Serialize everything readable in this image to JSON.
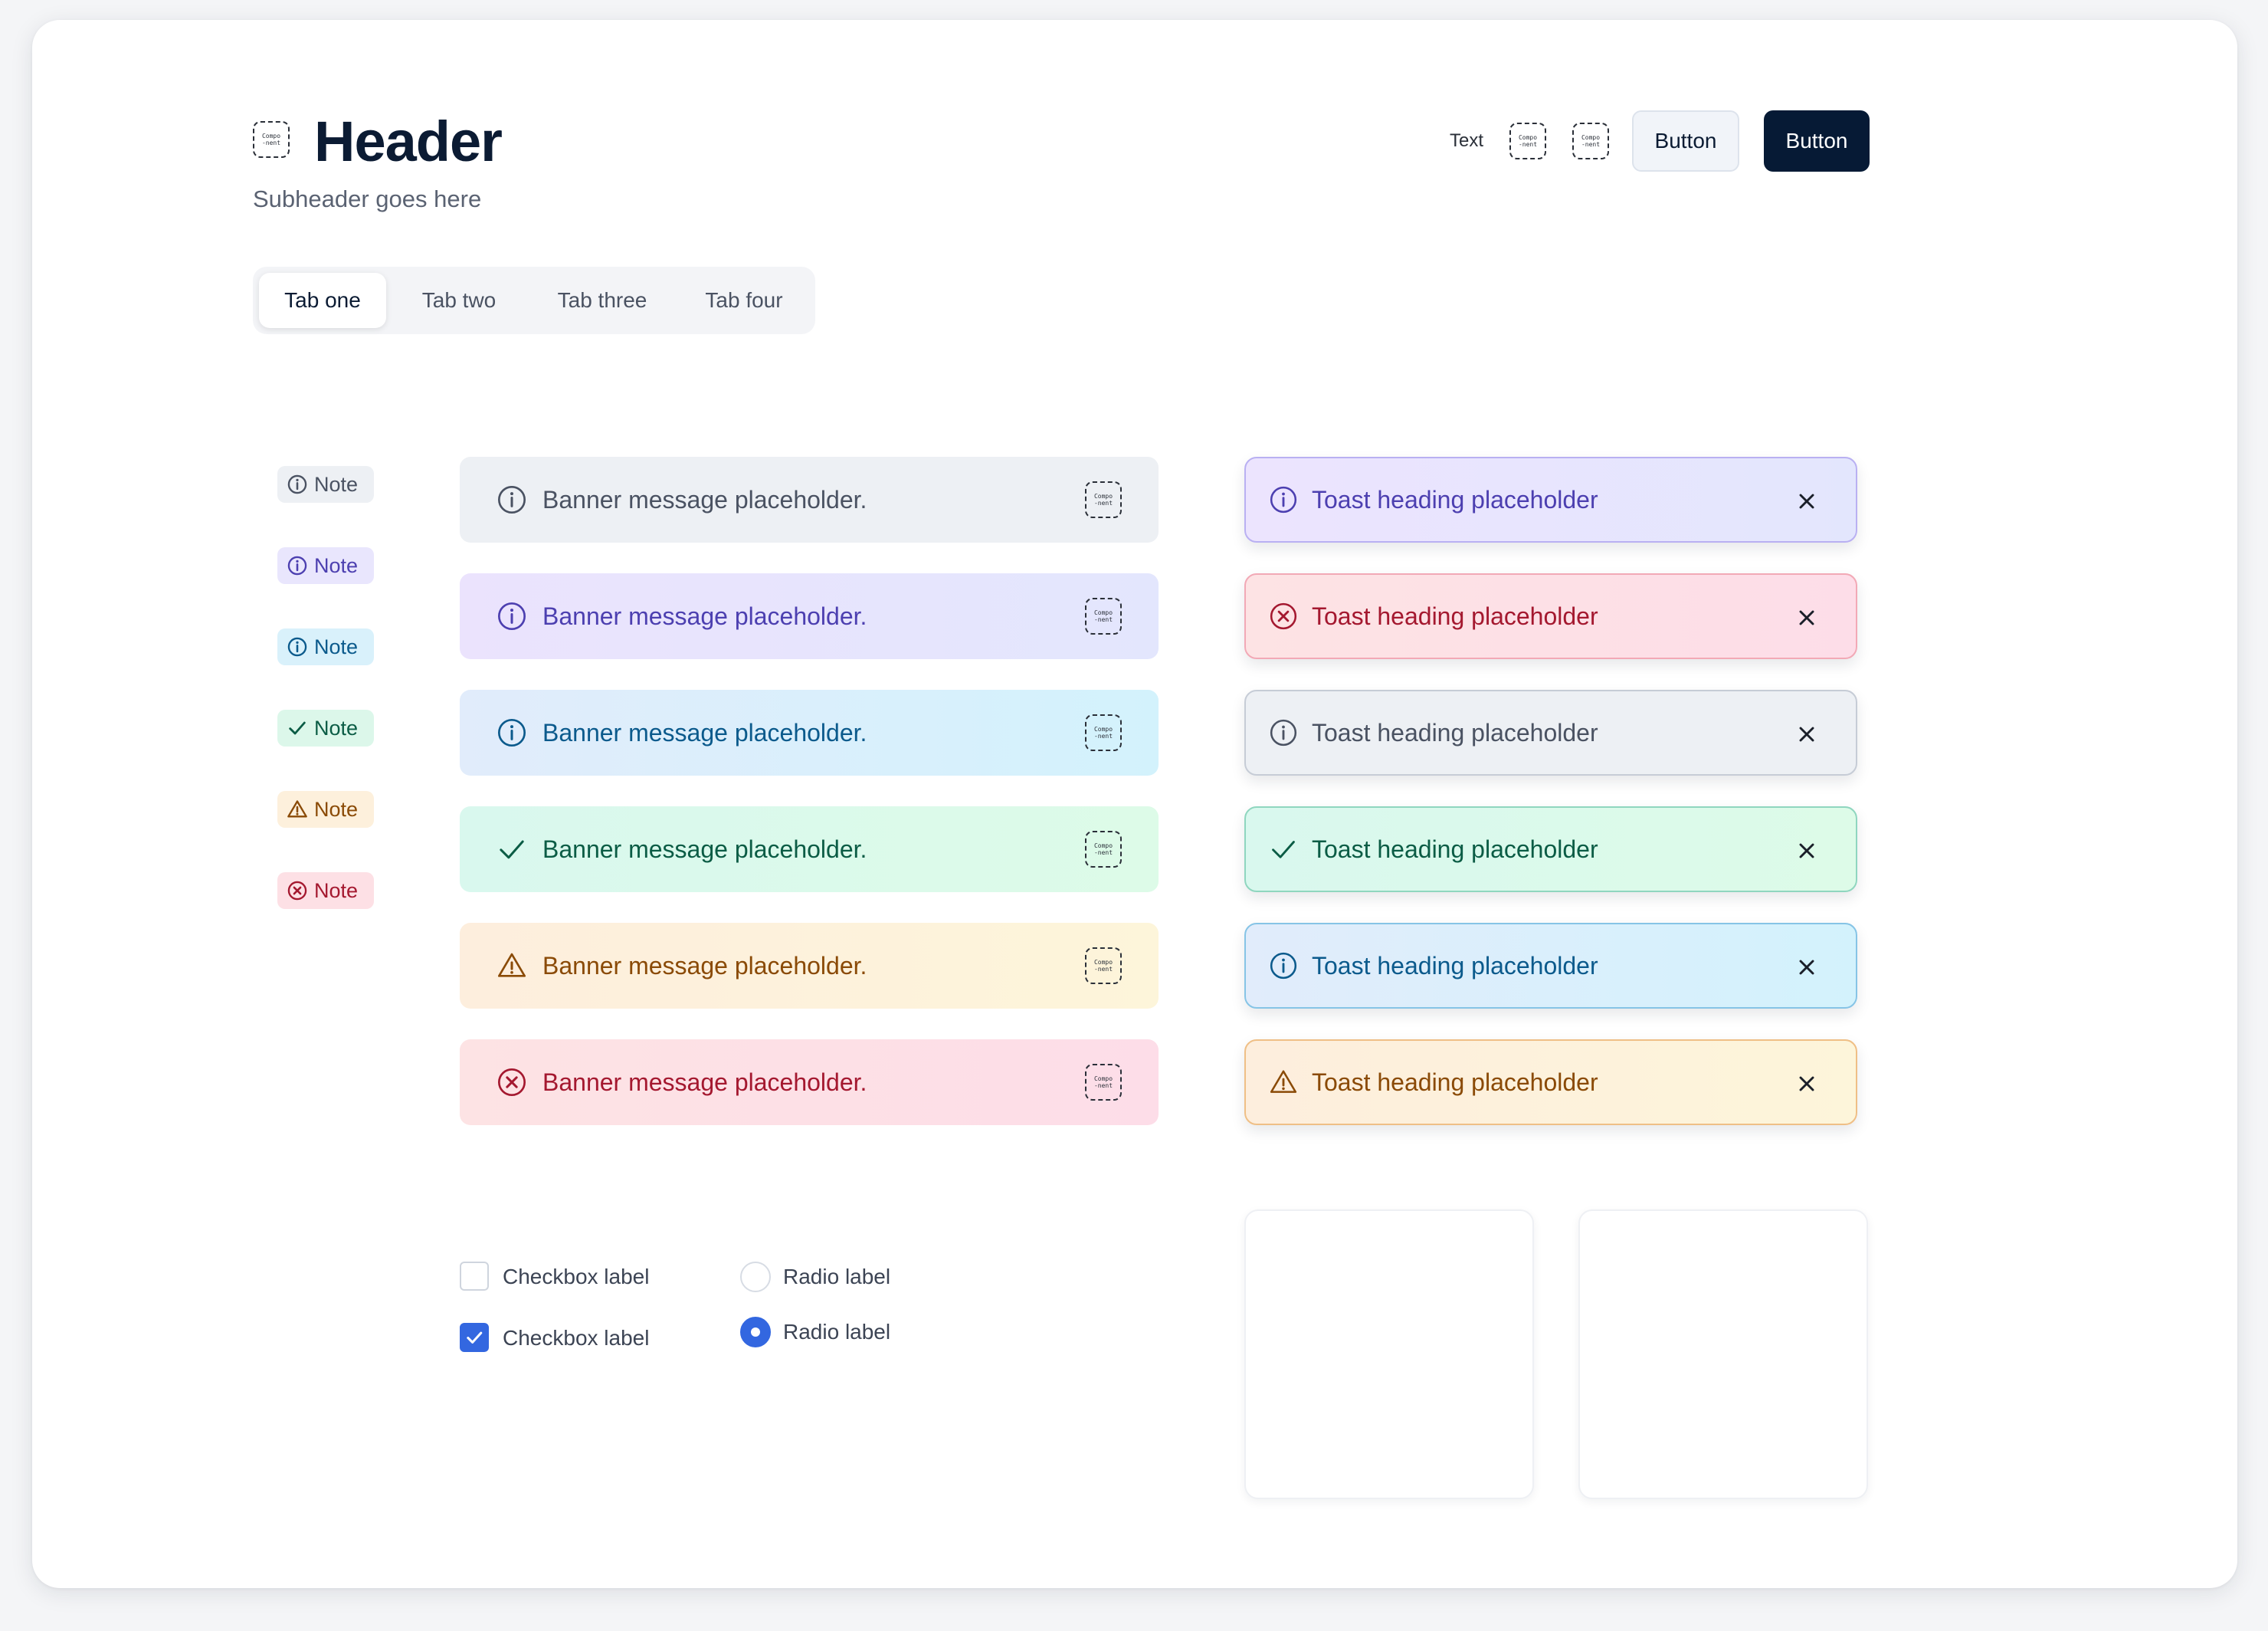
{
  "header": {
    "title": "Header",
    "subtitle": "Subheader goes here",
    "component_label_top": "Compo",
    "component_label_bottom": "-nent"
  },
  "actions": {
    "text": "Text",
    "button_secondary": "Button",
    "button_primary": "Button"
  },
  "tabs": [
    {
      "label": "Tab one",
      "active": true
    },
    {
      "label": "Tab two",
      "active": false
    },
    {
      "label": "Tab three",
      "active": false
    },
    {
      "label": "Tab four",
      "active": false
    }
  ],
  "notes": [
    {
      "label": "Note",
      "variant": "neutral",
      "icon": "info-icon"
    },
    {
      "label": "Note",
      "variant": "purple",
      "icon": "info-icon"
    },
    {
      "label": "Note",
      "variant": "blue",
      "icon": "info-icon"
    },
    {
      "label": "Note",
      "variant": "green",
      "icon": "check-icon"
    },
    {
      "label": "Note",
      "variant": "orange",
      "icon": "warning-icon"
    },
    {
      "label": "Note",
      "variant": "red",
      "icon": "error-icon"
    }
  ],
  "banners": [
    {
      "message": "Banner message placeholder.",
      "variant": "neutral",
      "icon": "info-icon"
    },
    {
      "message": "Banner message placeholder.",
      "variant": "purple",
      "icon": "info-icon"
    },
    {
      "message": "Banner message placeholder.",
      "variant": "blue",
      "icon": "info-icon"
    },
    {
      "message": "Banner message placeholder.",
      "variant": "green",
      "icon": "check-icon"
    },
    {
      "message": "Banner message placeholder.",
      "variant": "orange",
      "icon": "warning-icon"
    },
    {
      "message": "Banner message placeholder.",
      "variant": "red",
      "icon": "error-icon"
    }
  ],
  "toasts": [
    {
      "heading": "Toast heading placeholder",
      "variant": "purple",
      "icon": "info-icon"
    },
    {
      "heading": "Toast heading placeholder",
      "variant": "red",
      "icon": "error-icon"
    },
    {
      "heading": "Toast heading placeholder",
      "variant": "neutral",
      "icon": "info-icon"
    },
    {
      "heading": "Toast heading placeholder",
      "variant": "green",
      "icon": "check-icon"
    },
    {
      "heading": "Toast heading placeholder",
      "variant": "blue",
      "icon": "info-icon"
    },
    {
      "heading": "Toast heading placeholder",
      "variant": "orange",
      "icon": "warning-icon"
    }
  ],
  "checkboxes": [
    {
      "label": "Checkbox label",
      "checked": false
    },
    {
      "label": "Checkbox label",
      "checked": true
    }
  ],
  "radios": [
    {
      "label": "Radio label",
      "checked": false
    },
    {
      "label": "Radio label",
      "checked": true
    }
  ],
  "colors": {
    "primary_button": "#061a35",
    "accent": "#3367e0",
    "neutral_text": "#4a5262",
    "purple_text": "#4c3fb0",
    "blue_text": "#0b5a8c",
    "green_text": "#0b5c45",
    "orange_text": "#8a4a06",
    "red_text": "#a4182f"
  }
}
